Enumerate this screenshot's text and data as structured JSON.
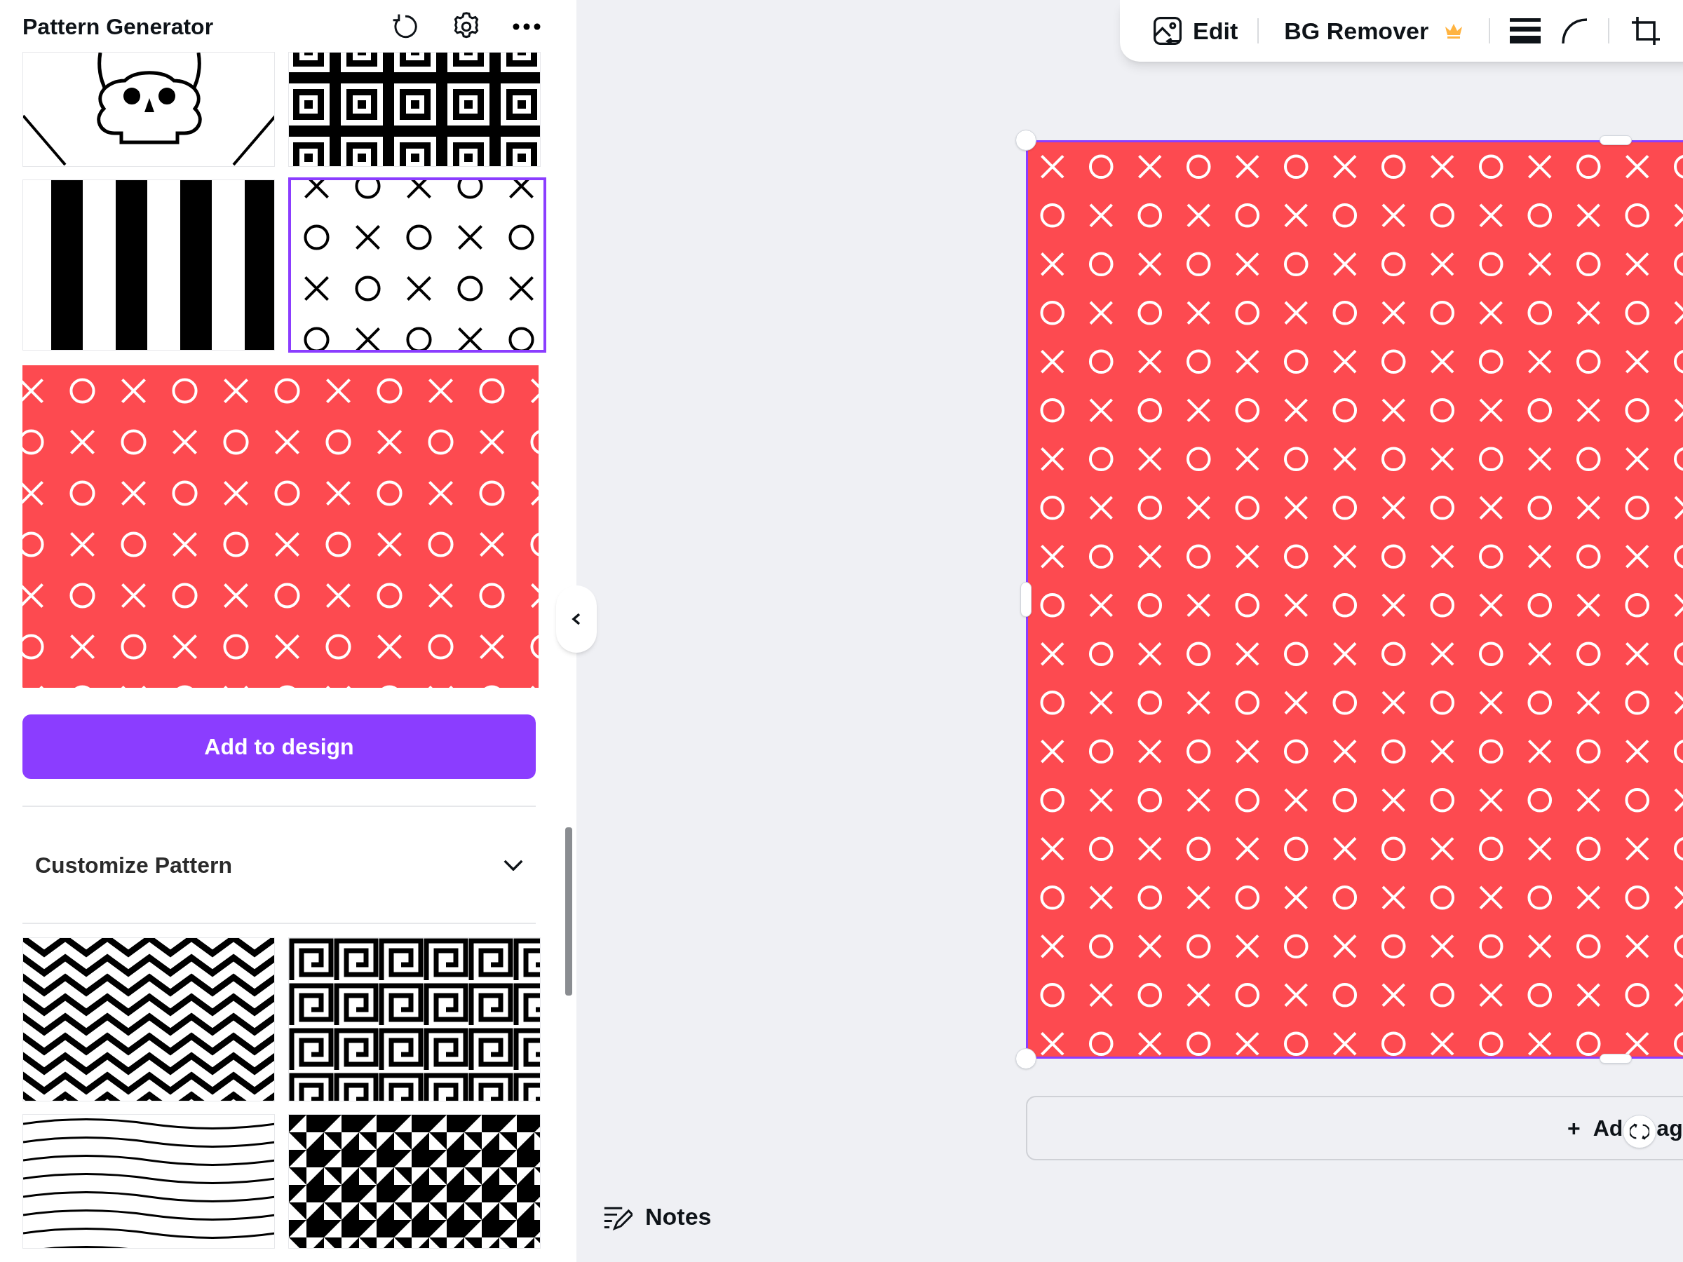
{
  "panel": {
    "title": "Pattern Generator",
    "thumbnails_top": [
      {
        "kind": "skull",
        "selected": false
      },
      {
        "kind": "squares",
        "selected": false
      },
      {
        "kind": "stripes",
        "selected": false
      },
      {
        "kind": "xo",
        "selected": true
      }
    ],
    "preview": {
      "kind": "xo_red"
    },
    "add_button": "Add to design",
    "customize": {
      "label": "Customize Pattern",
      "expanded": false
    },
    "thumbnails_bottom": [
      {
        "kind": "chevron",
        "selected": false
      },
      {
        "kind": "meander",
        "selected": false
      },
      {
        "kind": "waves",
        "selected": false
      },
      {
        "kind": "triangles",
        "selected": false
      }
    ]
  },
  "notes": "Notes",
  "toolbar": {
    "edit": "Edit",
    "bg_remover": "BG Remover"
  },
  "canvas": {
    "kind": "xo_red"
  },
  "add_page": {
    "icon": "+",
    "label_start": "Ad",
    "label_end": "ag"
  }
}
